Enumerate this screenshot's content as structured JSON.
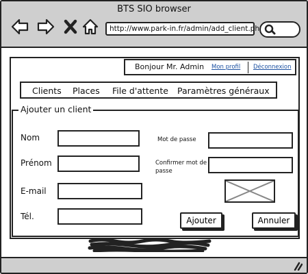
{
  "window": {
    "title": "BTS SIO browser"
  },
  "browser": {
    "url": "http://www.park-in.fr/admin/add_client.php",
    "icons": [
      "back-arrow-icon",
      "forward-arrow-icon",
      "close-x-icon",
      "home-icon",
      "search-icon"
    ]
  },
  "user_bar": {
    "greeting": "Bonjour Mr. Admin",
    "profile_link": "Mon profil",
    "logout_link": "Déconnexion"
  },
  "menu": {
    "items": [
      "Clients",
      "Places",
      "File d'attente",
      "Paramètres généraux"
    ]
  },
  "form": {
    "legend": "Ajouter un client",
    "labels": {
      "nom": "Nom",
      "prenom": "Prénom",
      "email": "E-mail",
      "tel": "Tél.",
      "password": "Mot de passe",
      "confirm_password": "Confirmer mot de passe"
    },
    "buttons": {
      "add": "Ajouter",
      "cancel": "Annuler"
    }
  },
  "colors": {
    "chrome": "#cfcfcf",
    "link": "#1a4fa0",
    "stroke": "#222222"
  }
}
